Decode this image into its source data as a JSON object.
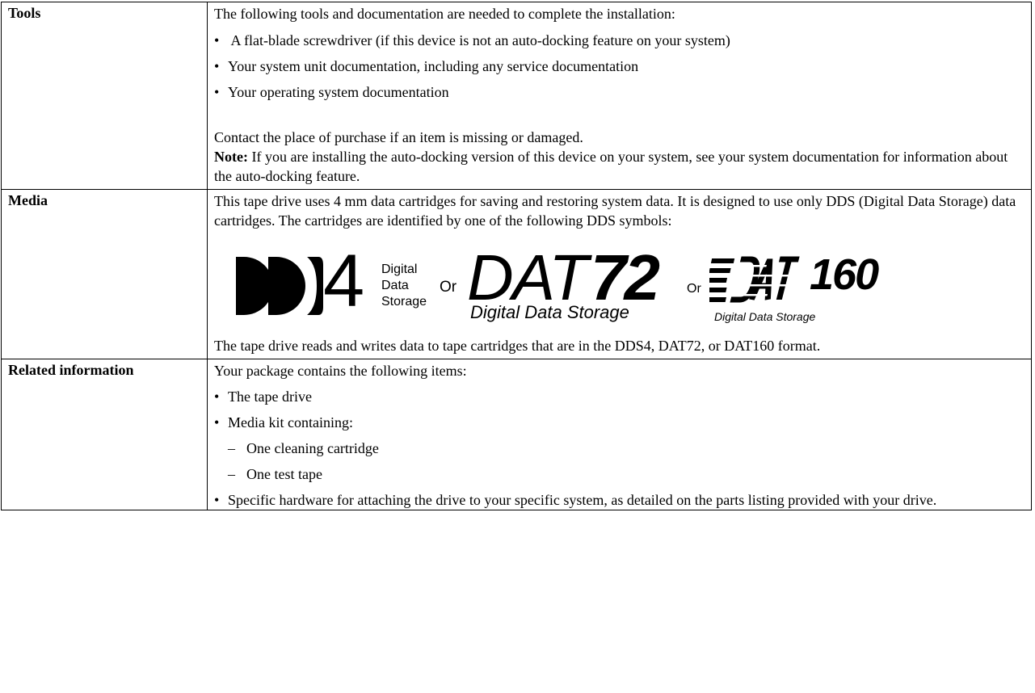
{
  "tools": {
    "label": "Tools",
    "intro": "The following tools and documentation are needed to complete the installation:",
    "items": [
      " A flat-blade screwdriver (if this device is not an auto-docking feature on your system)",
      "Your system unit documentation, including any service documentation",
      "Your operating system documentation"
    ],
    "contact": "Contact the place of purchase if an item is missing or damaged.",
    "note_label": "Note:",
    "note_text": " If you are installing the auto-docking version of this device on your system, see your system documentation for information about the auto-docking feature."
  },
  "media": {
    "label": "Media",
    "intro": "This tape drive uses 4 mm data cartridges for saving and restoring system data. It is designed to use only DDS (Digital Data Storage) data cartridges. The cartridges are identified by one of the following DDS symbols:",
    "logos": {
      "dds4_number": "4",
      "dds4_line1": "Digital",
      "dds4_line2": "Data",
      "dds4_line3": "Storage",
      "or1": "Or",
      "dat72_text": "DAT",
      "dat72_number": "72",
      "dat72_caption": "Digital Data Storage",
      "or2": "Or",
      "dat160_number": "160",
      "dat160_caption": "Digital Data Storage"
    },
    "after": "The tape drive reads and writes data to tape cartridges that are in the DDS4, DAT72, or DAT160 format."
  },
  "related": {
    "label": "Related information",
    "intro": "Your package contains the following items:",
    "item1": "The tape drive",
    "item2": "Media kit containing:",
    "sub_items": [
      "One cleaning cartridge",
      "One test tape"
    ],
    "item3": "Specific hardware for attaching the drive to your specific system, as detailed on the parts listing provided with your drive."
  },
  "glyphs": {
    "bullet": "•",
    "dash": "–"
  }
}
